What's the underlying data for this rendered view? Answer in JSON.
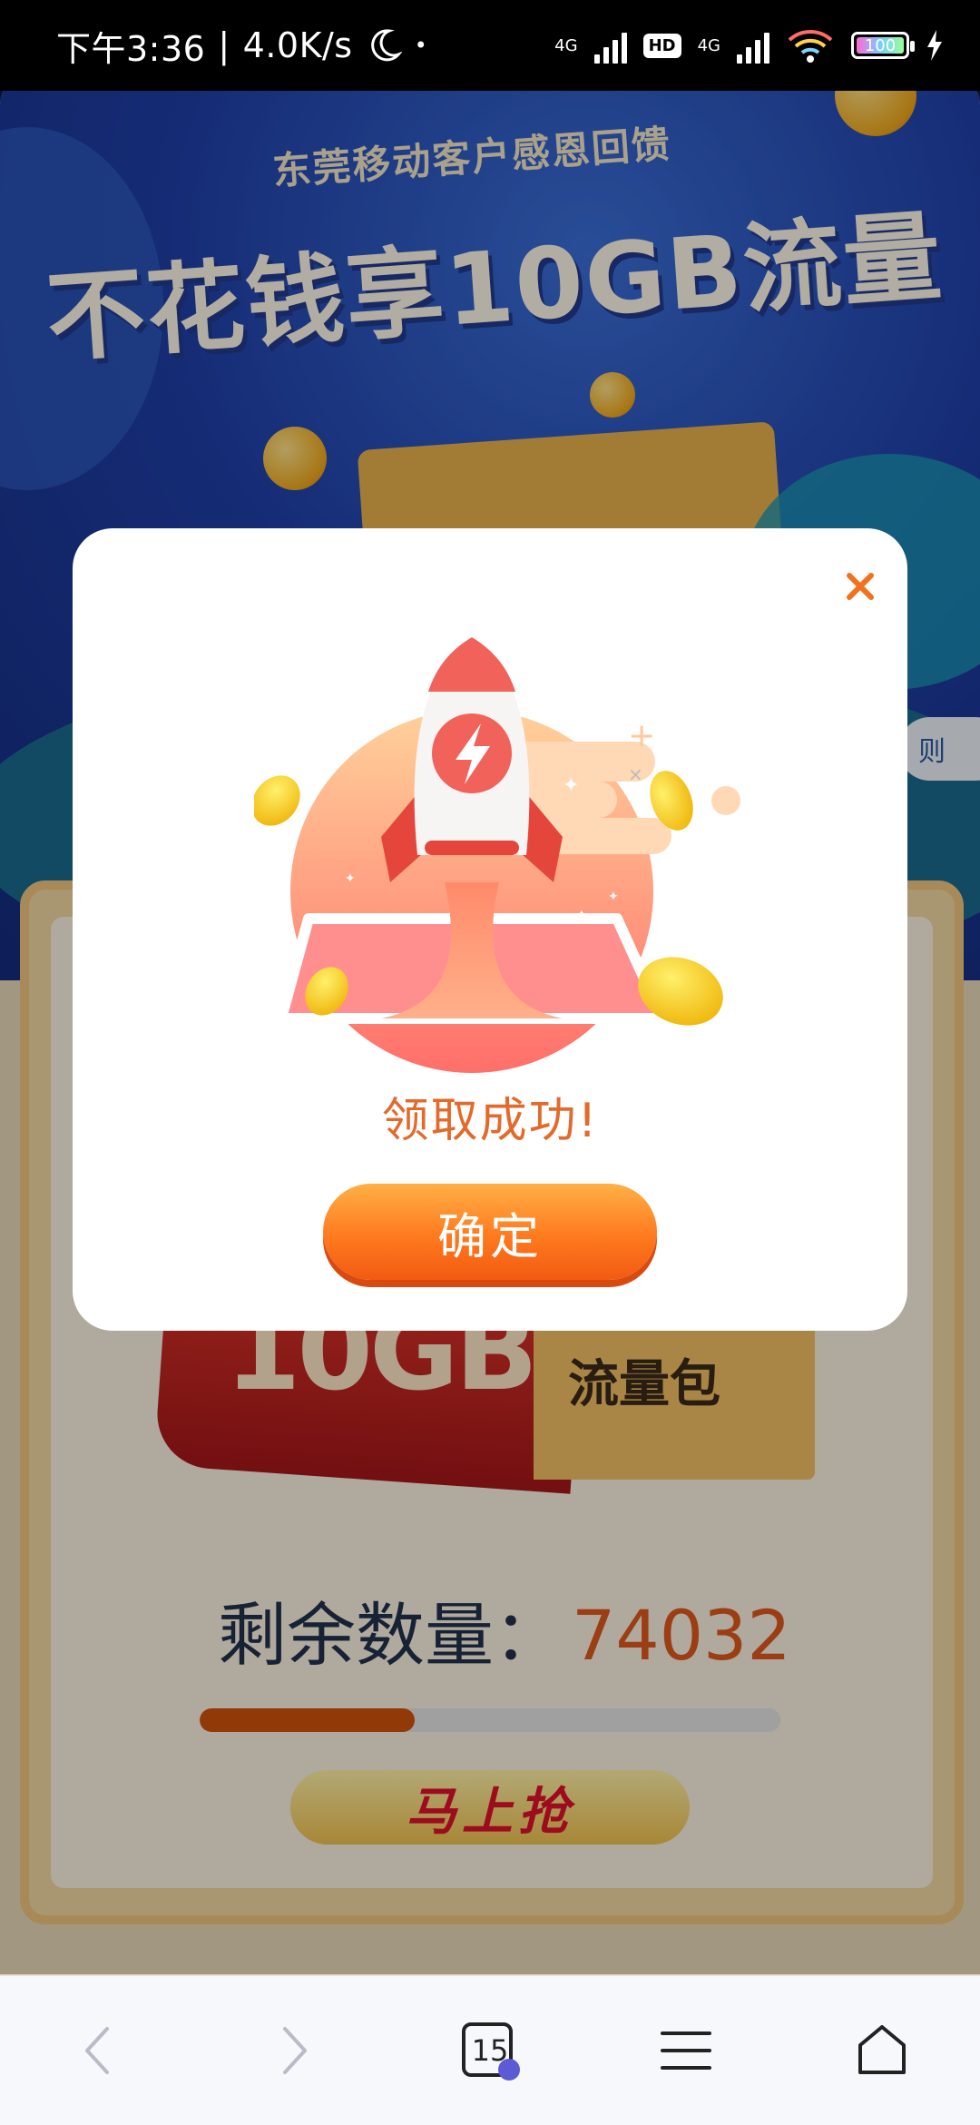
{
  "status_bar": {
    "time": "下午3:36",
    "speed": "4.0K/s",
    "network1": "4G",
    "hd": "HD",
    "network2": "4G",
    "battery": "100"
  },
  "banner": {
    "subtitle": "东莞移动客户感恩回馈",
    "headline": "不花钱享10GB流量",
    "rules_label": "则"
  },
  "card": {
    "packet_size": "10GB",
    "packet_label": "流量包",
    "remaining_label": "剩余数量：",
    "remaining_value": "74032",
    "progress": 0.37,
    "grab_button": "马上抢"
  },
  "modal": {
    "title": "领取成功!",
    "confirm_button": "确定"
  },
  "browser_nav": {
    "tab_count": "15"
  },
  "colors": {
    "accent": "#ff7a1e",
    "title": "#e36a2a",
    "banner": "#1f3fa8"
  }
}
